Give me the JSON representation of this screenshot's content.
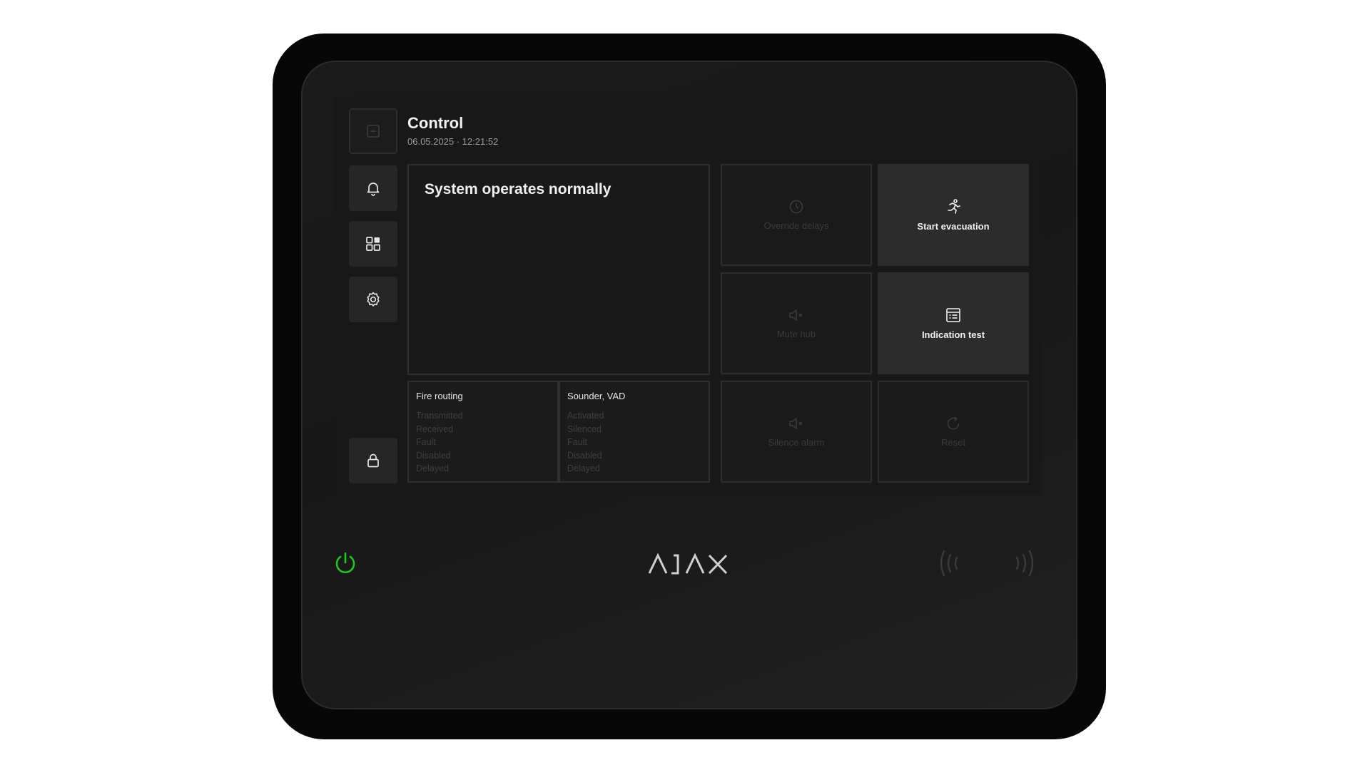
{
  "header": {
    "title": "Control",
    "date": "06.05.2025",
    "separator": "·",
    "time": "12:21:52"
  },
  "sidebar": {
    "items": [
      {
        "name": "collapse",
        "icon": "minus-square-icon"
      },
      {
        "name": "notifications",
        "icon": "bell-icon"
      },
      {
        "name": "dashboard",
        "icon": "grid-icon"
      },
      {
        "name": "settings",
        "icon": "gear-icon"
      },
      {
        "name": "lock",
        "icon": "lock-icon"
      }
    ]
  },
  "status": {
    "text": "System operates normally"
  },
  "fire_routing": {
    "title": "Fire routing",
    "items": [
      "Transmitted",
      "Received",
      "Fault",
      "Disabled",
      "Delayed"
    ]
  },
  "sounder": {
    "title": "Sounder, VAD",
    "items": [
      "Activated",
      "Silenced",
      "Fault",
      "Disabled",
      "Delayed"
    ]
  },
  "actions": {
    "override_delays": "Override delays",
    "start_evacuation": "Start evacuation",
    "mute_hub": "Mute hub",
    "indication_test": "Indication test",
    "silence_alarm": "Silence alarm",
    "reset": "Reset"
  },
  "colors": {
    "power_indicator": "#1fc71f",
    "active_text": "#f0f0f0",
    "disabled_text": "#3a3a3a"
  }
}
